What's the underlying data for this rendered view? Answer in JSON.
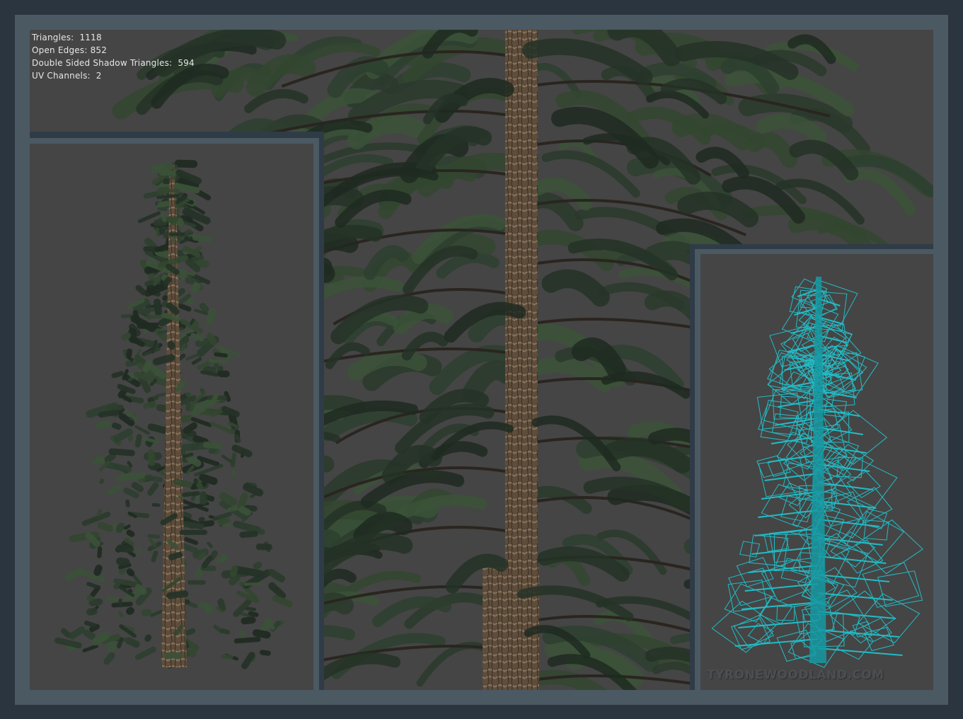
{
  "stats": {
    "triangles": "Triangles:  1118",
    "open_edges": "Open Edges: 852",
    "double_sided": "Double Sided Shadow Triangles:  594",
    "uv_channels": "UV Channels:  2"
  },
  "watermark": "TYRONEWOODLAND.COM",
  "colors": {
    "frame": "#4b5963",
    "outer": "#2a3540",
    "viewport": "#454545",
    "foliage": "#2b3a2c",
    "bark": "#6b5a45",
    "wireframe": "#1fc9d4"
  },
  "panels": [
    "main-closeup-view",
    "full-tree-view",
    "wireframe-view"
  ]
}
